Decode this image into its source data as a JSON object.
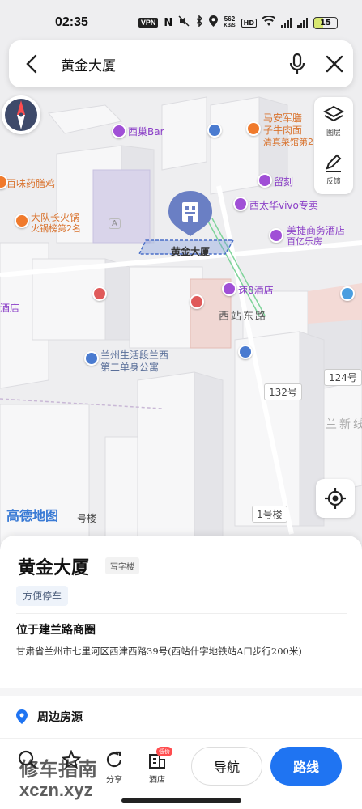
{
  "status_bar": {
    "time": "02:35",
    "vpn": "VPN",
    "speed_value": "562",
    "speed_unit": "KB/S",
    "hd": "HD",
    "battery": "15"
  },
  "search": {
    "query": "黄金大厦"
  },
  "map": {
    "side_buttons": [
      {
        "label": "图层",
        "icon": "layers-icon"
      },
      {
        "label": "反馈",
        "icon": "pen-icon"
      }
    ],
    "logo_text": "高德地图",
    "labels": {
      "west_bar": "西巢Bar",
      "maan_1": "马安军膳",
      "maan_2": "子牛肉面",
      "maan_3": "清真菜馆第2",
      "baiwei": "百味药膳鸡",
      "liu_ke": "留刻",
      "xitaihua": "西太华vivo专卖",
      "dadui_1": "大队长火锅",
      "dadui_2": "火锅榜第2名",
      "meijie_1": "美捷商务酒店",
      "meijie_2": "百亿乐房",
      "jinghotel": "速8酒店",
      "hotel_left": "酒店",
      "xizhan_road": "西站东路",
      "shenghuo_1": "兰州生活段兰西",
      "shenghuo_2": "第二单身公寓",
      "lanxin": "兰新线",
      "building_name": "黄金大厦",
      "area_a": "A"
    },
    "road_tags": [
      "124号",
      "132号",
      "1号楼",
      "号楼"
    ]
  },
  "place": {
    "title": "黄金大厦",
    "type": "写字楼",
    "tag": "方便停车",
    "location_heading": "位于建兰路商圈",
    "address": "甘肃省兰州市七里河区西津西路39号(西站什字地铁站A口步行200米)",
    "nearby_label": "周边房源"
  },
  "actions": {
    "search_label": "",
    "favorite_label": "",
    "share_label": "分享",
    "hotel_label": "酒店",
    "hotel_badge": "低价",
    "navigate_label": "导航",
    "route_label": "路线"
  },
  "watermark": {
    "line1": "修车指南",
    "line2": "xczn.xyz"
  },
  "colors": {
    "accent": "#1f74f2",
    "pin": "#6a7fc4",
    "poi_purple": "#a04fd6",
    "poi_orange": "#f07a2c",
    "poi_blue": "#4a7bd0"
  }
}
